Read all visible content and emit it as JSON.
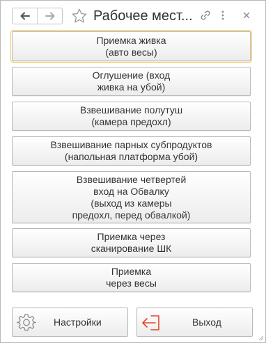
{
  "window": {
    "title": "Рабочее мест..."
  },
  "icons": {
    "back": "arrow-left-icon",
    "forward": "arrow-right-icon",
    "favorite": "star-outline-icon",
    "link": "link-icon",
    "more": "more-vertical-icon",
    "close": "close-icon",
    "settings": "gear-icon",
    "exit": "exit-arrow-icon"
  },
  "colors": {
    "focus_outline": "#f0c95a",
    "exit_icon": "#e8412c",
    "nav_icon": "#555555"
  },
  "menu": {
    "buttons": [
      {
        "label": "Приемка живка\n(авто весы)"
      },
      {
        "label": "Оглушение (вход\nживка на убой)"
      },
      {
        "label": "Взвешивание полутуш\n(камера предохл)"
      },
      {
        "label": "Взвешивание парных субпродуктов\n(напольная платформа убой)"
      },
      {
        "label": "Взвешивание четвертей\nвход на Обвалку\n(выход из камеры\nпредохл, перед обвалкой)"
      },
      {
        "label": "Приемка через\nсканирование ШК"
      },
      {
        "label": "Приемка\nчерез весы"
      }
    ]
  },
  "footer": {
    "settings_label": "Настройки",
    "exit_label": "Выход"
  }
}
